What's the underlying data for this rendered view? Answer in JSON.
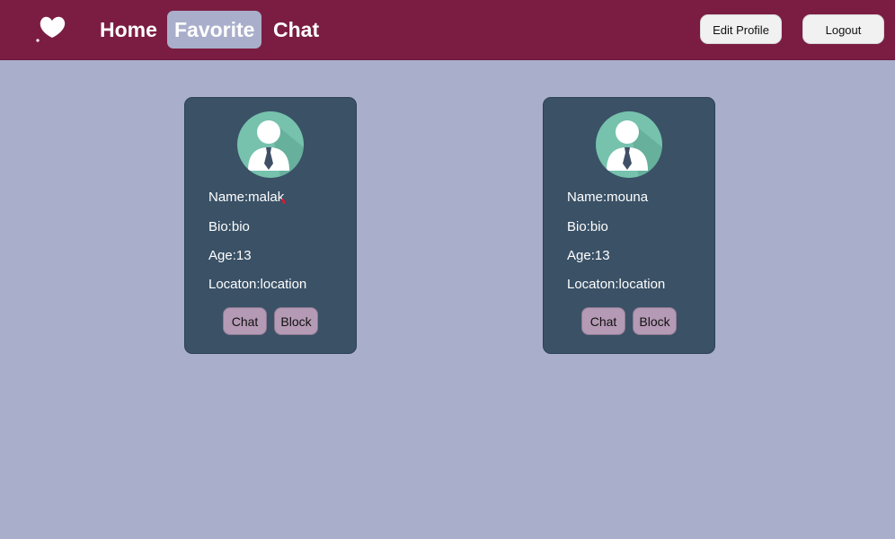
{
  "nav": {
    "home": "Home",
    "favorite": "Favorite",
    "chat": "Chat",
    "edit_profile": "Edit Profile",
    "logout": "Logout",
    "logo_icon": "heart-logo-icon"
  },
  "cards": [
    {
      "name": "Name:malak",
      "bio": "Bio:bio",
      "age": "Age:13",
      "location": "Locaton:location",
      "chat_label": "Chat",
      "block_label": "Block"
    },
    {
      "name": "Name:mouna",
      "bio": "Bio:bio",
      "age": "Age:13",
      "location": "Locaton:location",
      "chat_label": "Chat",
      "block_label": "Block"
    }
  ],
  "colors": {
    "navbar": "#7b1d42",
    "page_bg": "#a9aecb",
    "card_bg": "#3a5166",
    "card_button": "#b49ab5",
    "avatar_bg": "#76c2ad"
  }
}
